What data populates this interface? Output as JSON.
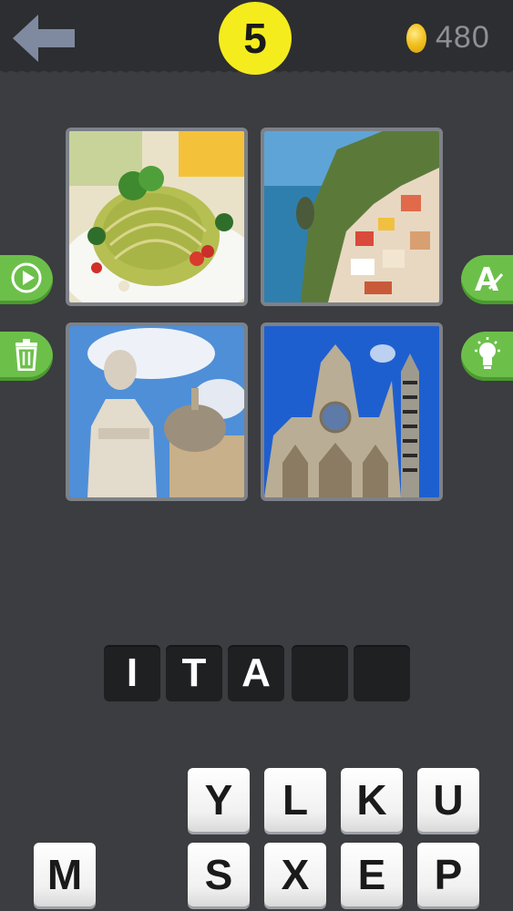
{
  "header": {
    "level": "5",
    "coins": "480"
  },
  "icons": {
    "back": "back-arrow-icon",
    "coin": "coin-icon",
    "play": "play-icon",
    "trash": "trash-icon",
    "reveal": "reveal-letter-icon",
    "hint": "lightbulb-icon"
  },
  "pictures": [
    {
      "subject": "pesto-pasta"
    },
    {
      "subject": "coastal-village"
    },
    {
      "subject": "statue-and-dome"
    },
    {
      "subject": "gothic-cathedral"
    }
  ],
  "answer": {
    "slots": [
      "I",
      "T",
      "A",
      "",
      ""
    ]
  },
  "keyboard": {
    "row1": [
      "Y",
      "L",
      "K",
      "U"
    ],
    "row2": [
      "M",
      "S",
      "X",
      "E",
      "P"
    ]
  },
  "colors": {
    "background": "#3b3d40",
    "topbar": "#2c2e31",
    "level_badge": "#f5ec1e",
    "side_button": "#6cc04a",
    "slot": "#1f2022",
    "key": "#ffffff"
  }
}
